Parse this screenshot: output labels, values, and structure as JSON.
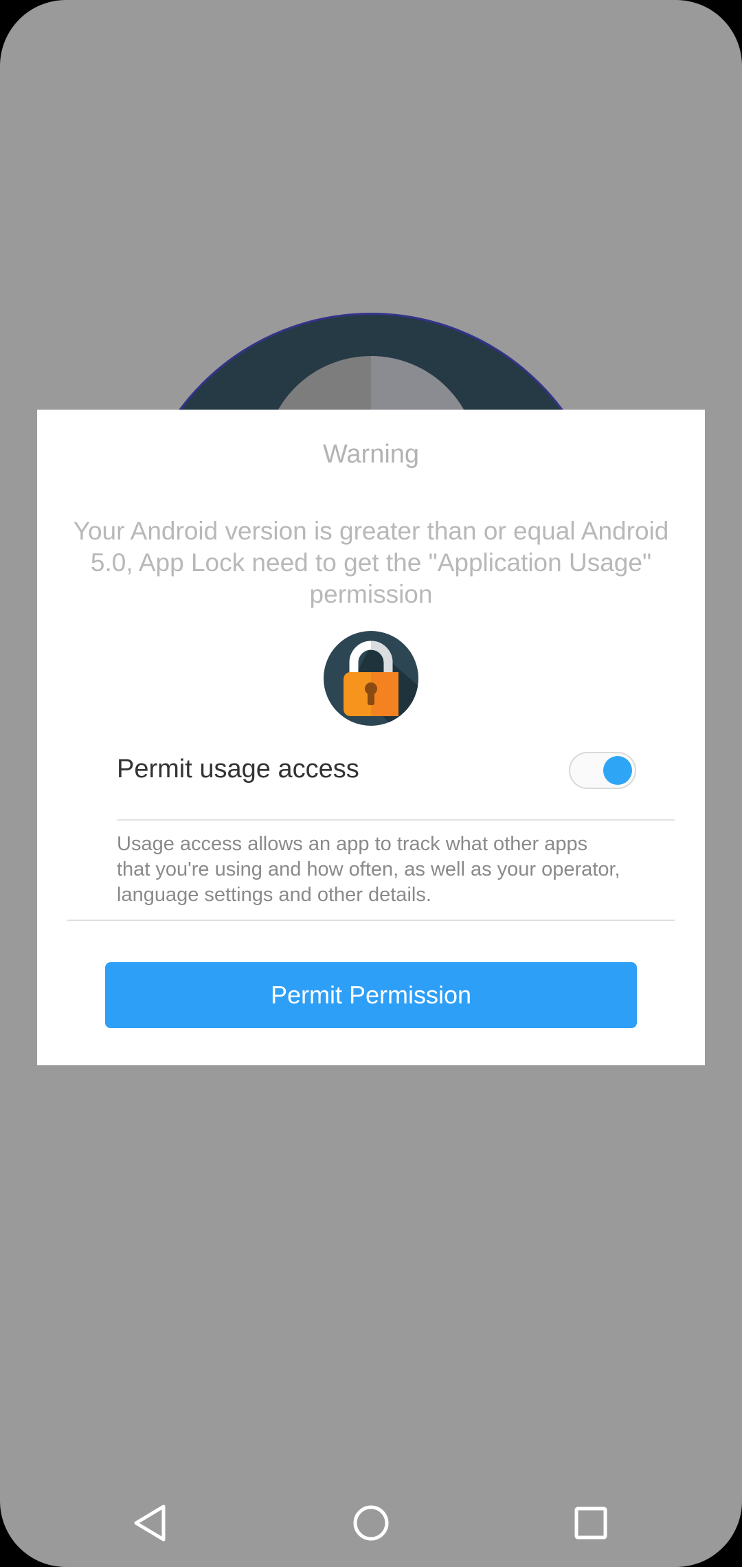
{
  "dialog": {
    "title": "Warning",
    "message": "Your Android version is greater than or equal Android 5.0, App Lock need to get the \"Application Usage\" permission",
    "icon": "padlock-icon",
    "settings_preview": {
      "label": "Permit usage access",
      "toggle_on": true,
      "description": "Usage access allows an app to track what other apps that you're using and how often, as well as your operator, language settings and other details."
    },
    "button_label": "Permit Permission"
  },
  "colors": {
    "accent": "#2e9ff7",
    "scrim": "#9a9a9a",
    "lock_body": "#f7941d",
    "lock_circle": "#2c4653"
  },
  "nav_bar": {
    "buttons": [
      "back-icon",
      "home-icon",
      "recents-icon"
    ]
  }
}
